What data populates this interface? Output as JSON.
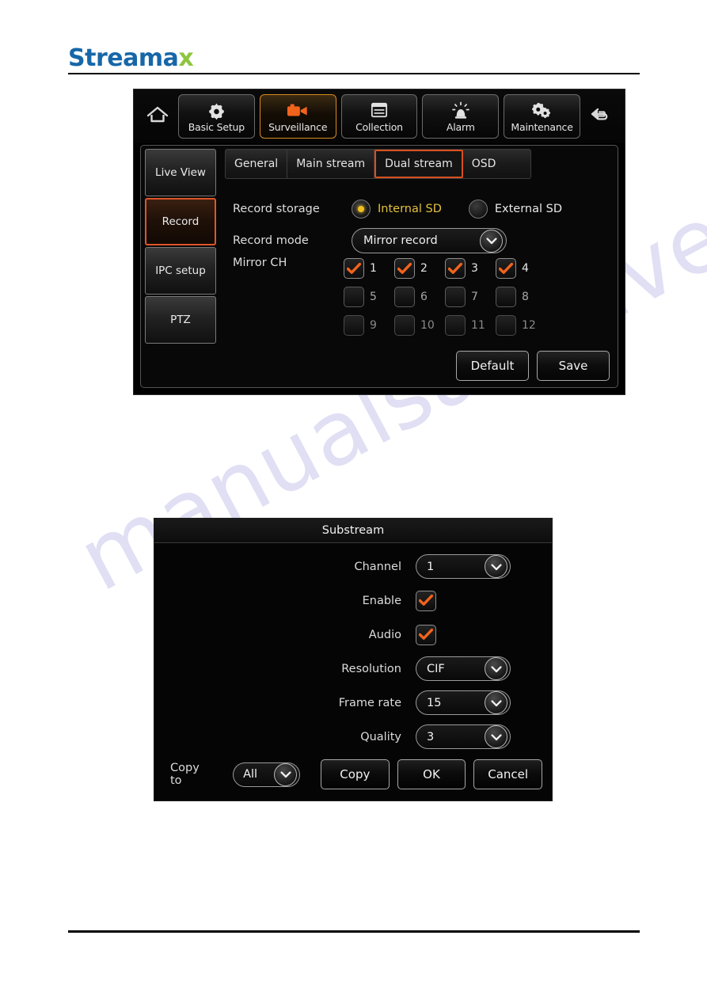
{
  "brand": {
    "name_main": "Streama",
    "name_accent": "x"
  },
  "watermark": {
    "text": "manualsarchive.com"
  },
  "device_panel": {
    "toolbar": {
      "home_icon": "home-icon",
      "back_icon": "back-arrow-icon",
      "items": [
        {
          "label": "Basic Setup",
          "icon": "gear-icon",
          "active": false
        },
        {
          "label": "Surveillance",
          "icon": "video-camera-icon",
          "active": true
        },
        {
          "label": "Collection",
          "icon": "document-list-icon",
          "active": false
        },
        {
          "label": "Alarm",
          "icon": "alarm-beacon-icon",
          "active": false
        },
        {
          "label": "Maintenance",
          "icon": "double-gear-icon",
          "active": false
        }
      ]
    },
    "sidebar": {
      "items": [
        {
          "label": "Live View",
          "active": false
        },
        {
          "label": "Record",
          "active": true
        },
        {
          "label": "IPC setup",
          "active": false
        },
        {
          "label": "PTZ",
          "active": false
        }
      ]
    },
    "tabs": [
      {
        "label": "General",
        "active": false
      },
      {
        "label": "Main stream",
        "active": false
      },
      {
        "label": "Dual stream",
        "active": true
      },
      {
        "label": "OSD",
        "active": false
      }
    ],
    "record_storage": {
      "label": "Record storage",
      "options": [
        {
          "label": "Internal SD",
          "selected": true
        },
        {
          "label": "External SD",
          "selected": false
        }
      ]
    },
    "record_mode": {
      "label": "Record mode",
      "value": "Mirror record"
    },
    "mirror_ch": {
      "label": "Mirror CH",
      "channels": [
        {
          "num": "1",
          "checked": true
        },
        {
          "num": "2",
          "checked": true
        },
        {
          "num": "3",
          "checked": true
        },
        {
          "num": "4",
          "checked": true
        },
        {
          "num": "5",
          "checked": false
        },
        {
          "num": "6",
          "checked": false
        },
        {
          "num": "7",
          "checked": false
        },
        {
          "num": "8",
          "checked": false
        },
        {
          "num": "9",
          "checked": false
        },
        {
          "num": "10",
          "checked": false
        },
        {
          "num": "11",
          "checked": false
        },
        {
          "num": "12",
          "checked": false
        }
      ]
    },
    "footer": {
      "default_label": "Default",
      "save_label": "Save"
    }
  },
  "substream_dialog": {
    "title": "Substream",
    "rows": [
      {
        "label": "Channel",
        "type": "select",
        "value": "1"
      },
      {
        "label": "Enable",
        "type": "checkbox",
        "checked": true
      },
      {
        "label": "Audio",
        "type": "checkbox",
        "checked": true
      },
      {
        "label": "Resolution",
        "type": "select",
        "value": "CIF"
      },
      {
        "label": "Frame rate",
        "type": "select",
        "value": "15"
      },
      {
        "label": "Quality",
        "type": "select",
        "value": "3"
      }
    ],
    "footer": {
      "copy_to_label": "Copy to",
      "copy_to_value": "All",
      "copy_label": "Copy",
      "ok_label": "OK",
      "cancel_label": "Cancel"
    }
  },
  "colors": {
    "brand_blue": "#1767a8",
    "brand_green": "#8cc63f",
    "accent_orange": "#e0552a",
    "selected_yellow": "#e3c13f",
    "tab_active_border": "#d8501f"
  }
}
